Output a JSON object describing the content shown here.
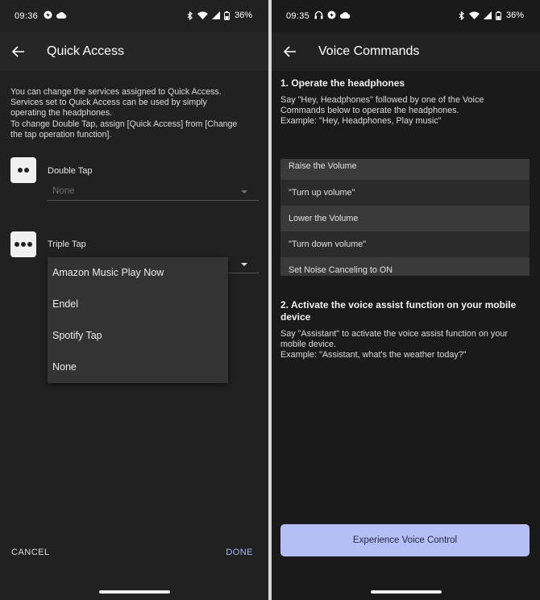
{
  "left_screen": {
    "status": {
      "time": "09:36",
      "battery": "36%"
    },
    "header": {
      "title": "Quick Access"
    },
    "description": [
      "You can change the services assigned to Quick Access.",
      "Services set to Quick Access can be used by simply",
      "operating the headphones.",
      "To change Double Tap, assign [Quick Access] from [Change",
      "the tap operation function]."
    ],
    "double_tap": {
      "label": "Double Tap",
      "value": "None"
    },
    "triple_tap": {
      "label": "Triple Tap"
    },
    "dropdown_options": [
      "Amazon Music Play Now",
      "Endel",
      "Spotify Tap",
      "None"
    ],
    "footer": {
      "cancel_label": "CANCEL",
      "done_label": "DONE"
    }
  },
  "right_screen": {
    "status": {
      "time": "09:35",
      "battery": "36%"
    },
    "header": {
      "title": "Voice Commands"
    },
    "section1": {
      "title": "1. Operate the headphones",
      "desc": [
        "Say \"Hey, Headphones\" followed by one of the Voice",
        "Commands below to operate the headphones.",
        "Example: \"Hey, Headphones, Play music\""
      ]
    },
    "commands": [
      "Raise the Volume",
      "\"Turn up volume\"",
      "Lower the Volume",
      "\"Turn down volume\"",
      "Set Noise Canceling to ON"
    ],
    "section2": {
      "title": "2. Activate the voice assist function on your mobile device",
      "desc": [
        "Say \"Assistant\" to activate the voice assist function on your",
        "mobile device.",
        "Example: \"Assistant, what's the weather today?\""
      ]
    },
    "cta_label": "Experience Voice Control"
  },
  "colors": {
    "accent": "#b6bff5",
    "done_text": "#b0b8f0",
    "background_left": "#212121",
    "background_right": "#1a1a1a"
  },
  "icons": [
    "back-arrow-icon",
    "bluetooth-icon",
    "wifi-icon",
    "signal-icon",
    "battery-icon",
    "headphones-icon",
    "cloud-icon",
    "app-notification-icon"
  ]
}
